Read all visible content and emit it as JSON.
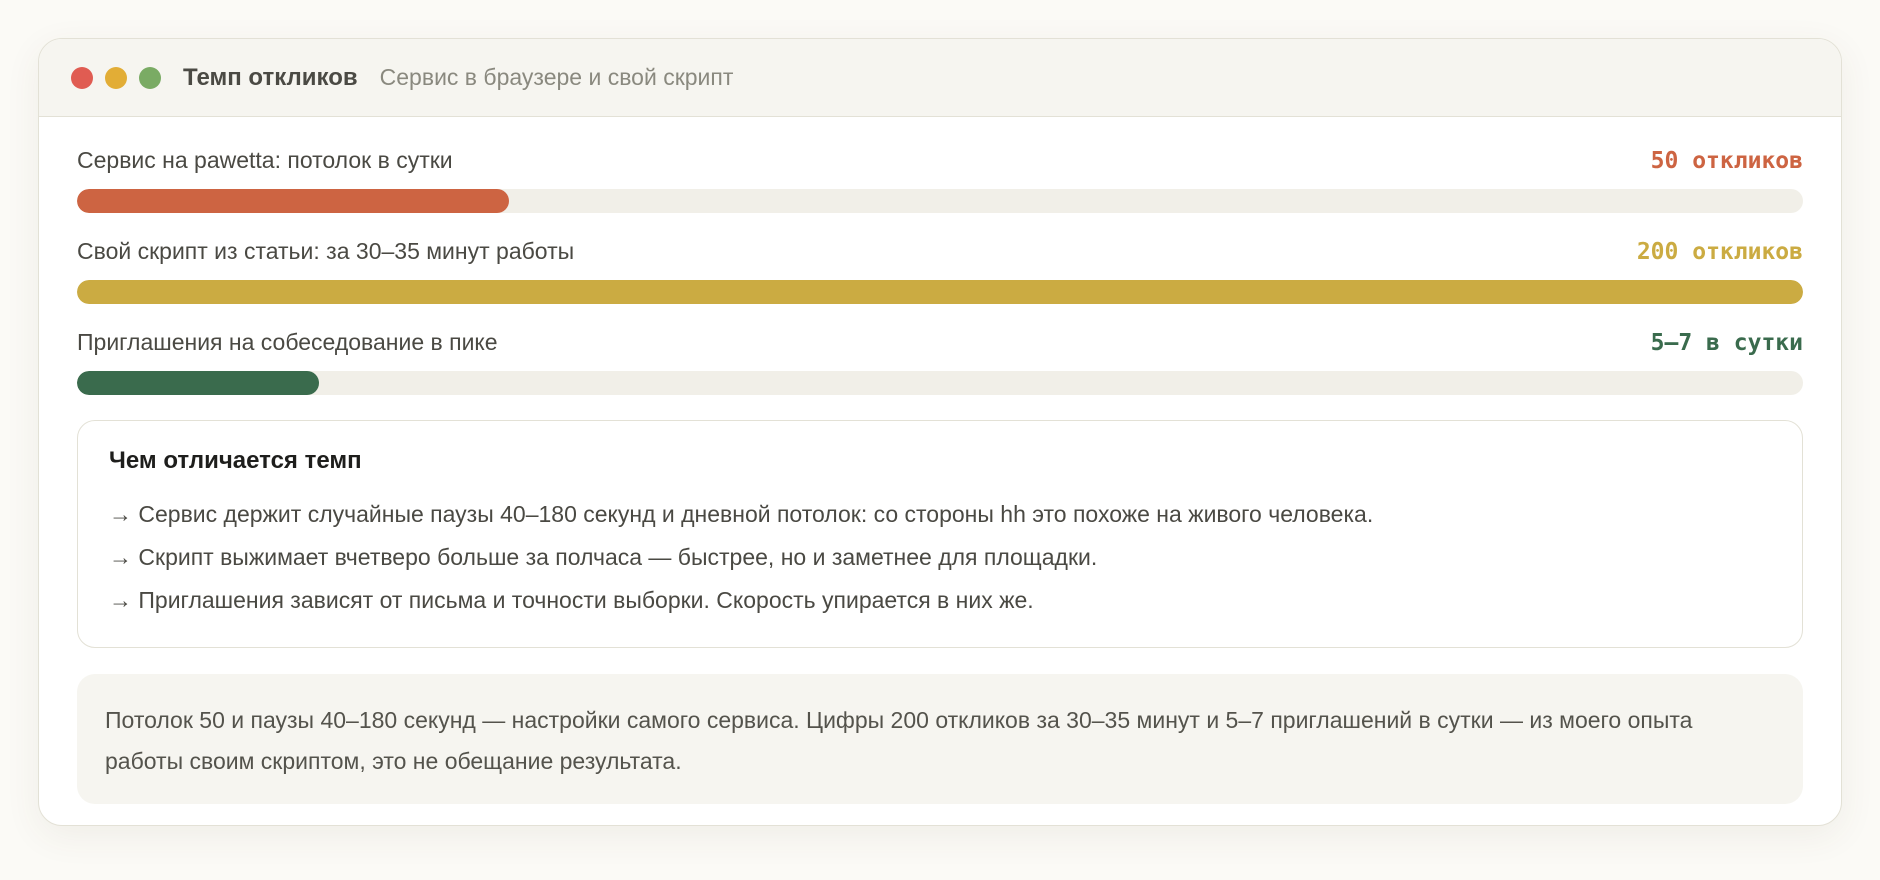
{
  "window": {
    "title": "Темп откликов",
    "subtitle": "Сервис в браузере и свой скрипт"
  },
  "metrics": [
    {
      "label": "Сервис на pawetta: потолок в сутки",
      "value_text": "50 откликов",
      "fill_fraction": 0.25,
      "color": "#cd6442"
    },
    {
      "label": "Свой скрипт из статьи: за 30–35 минут работы",
      "value_text": "200 откликов",
      "fill_fraction": 1.0,
      "color": "#cbab42"
    },
    {
      "label": "Приглашения на собеседование в пике",
      "value_text": "5–7 в сутки",
      "fill_fraction": 0.14,
      "color": "#3a6b4d"
    }
  ],
  "info": {
    "title": "Чем отличается темп",
    "items": [
      "→ Сервис держит случайные паузы 40–180 секунд и дневной потолок: со стороны hh это похоже на живого человека.",
      "→ Скрипт выжимает вчетверо больше за полчаса — быстрее, но и заметнее для площадки.",
      "→ Приглашения зависят от письма и точности выборки. Скорость упирается в них же."
    ]
  },
  "note": {
    "text": "Потолок 50 и паузы 40–180 секунд — настройки самого сервиса. Цифры 200 откликов за 30–35 минут и 5–7 приглашений в сутки — из моего опыта работы своим скриптом, это не обещание результата."
  }
}
